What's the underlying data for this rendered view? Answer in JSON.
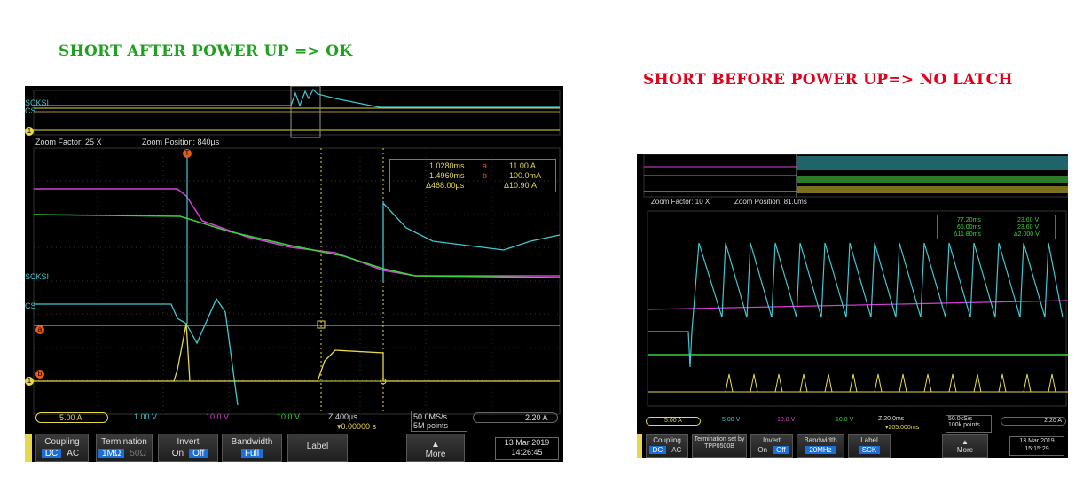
{
  "left": {
    "caption": "SHORT AFTER POWER UP => OK",
    "channels": {
      "scksi_top": "SCKSI",
      "cs_top": "CS",
      "scksi_mid": "SCKSI",
      "cs_mid": "CS",
      "marker_a": "a",
      "marker_b": "b",
      "marker_1": "1",
      "marker_2": "2",
      "marker_3": "3",
      "marker_T": "T"
    },
    "zoom_factor": "Zoom Factor: 25 X",
    "zoom_position": "Zoom Position: 840µs",
    "cursor_readout": {
      "t1": "1.0280ms",
      "t2": "1.4960ms",
      "dt": "Δ468.00µs",
      "a_label": "a",
      "a_val": "11.00 A",
      "b_label": "b",
      "b_val": "100.0mA",
      "dv": "Δ10.90 A"
    },
    "status": {
      "ch1": "5.00 A",
      "ch2": "1.00 V",
      "ch3": "10.0 V",
      "ch4": "10.0 V",
      "horiz": "Z 400µs",
      "delay": "▾0.00000 s",
      "rate": "50.0MS/s",
      "points": "5M points",
      "trig_ch": "1",
      "trig_level": "2.20 A"
    },
    "menu": {
      "coupling": "Coupling",
      "dc": "DC",
      "ac": "AC",
      "termination": "Termination",
      "ohm1m": "1MΩ",
      "ohm50": "50Ω",
      "invert": "Invert",
      "inv_on": "On",
      "inv_off": "Off",
      "bandwidth": "Bandwidth",
      "bw_full": "Full",
      "label": "Label",
      "more": "More",
      "date": "13 Mar 2019",
      "time": "14:26:45"
    }
  },
  "right": {
    "caption": "SHORT BEFORE POWER UP=> NO LATCH",
    "zoom_factor": "Zoom Factor: 10 X",
    "zoom_position": "Zoom Position: 81.0ms",
    "cursor_readout": {
      "t1": "77.20ms",
      "t2": "65.00ms",
      "dt": "Δ11.80ms",
      "a_val": "23.60 V",
      "b_val": "23.60 V",
      "dv": "Δ2.000 V"
    },
    "status": {
      "ch1": "5.00 A",
      "ch2": "5.00 V",
      "ch3": "10.0 V",
      "ch4": "10.0 V",
      "horiz": "Z 20.0ms",
      "delay": "▾205.000ms",
      "rate": "50.0kS/s",
      "points": "100k points",
      "trig_level": "2.20 A"
    },
    "menu": {
      "coupling": "Coupling",
      "dc": "DC",
      "ac": "AC",
      "termination": "Termination set by TPP0500B",
      "invert": "Invert",
      "inv_on": "On",
      "inv_off": "Off",
      "bandwidth": "Bandwidth",
      "bw_val": "20MHz",
      "label": "Label",
      "label_val": "SCK",
      "more": "More",
      "date": "13 Mar 2019",
      "time": "15:15:29"
    }
  },
  "colors": {
    "ch1": "#e6d84a",
    "ch2": "#3ec9d4",
    "ch3": "#d63fd6",
    "ch4": "#39d23a",
    "marker": "#e35a1a",
    "caption_ok": "#1fa020",
    "caption_bad": "#e3001b"
  }
}
